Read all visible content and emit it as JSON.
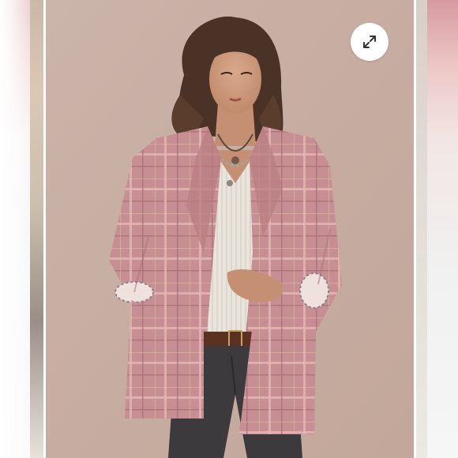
{
  "viewer": {
    "main_image": {
      "alt": "",
      "backdrop_color": "#c7ada1",
      "jacket_color": "#c78f93"
    },
    "expand_button": {
      "icon": "expand-arrows-icon"
    },
    "previous_image_peek": {
      "icon": "none"
    },
    "next_image_peek": {
      "icon": "none"
    }
  }
}
